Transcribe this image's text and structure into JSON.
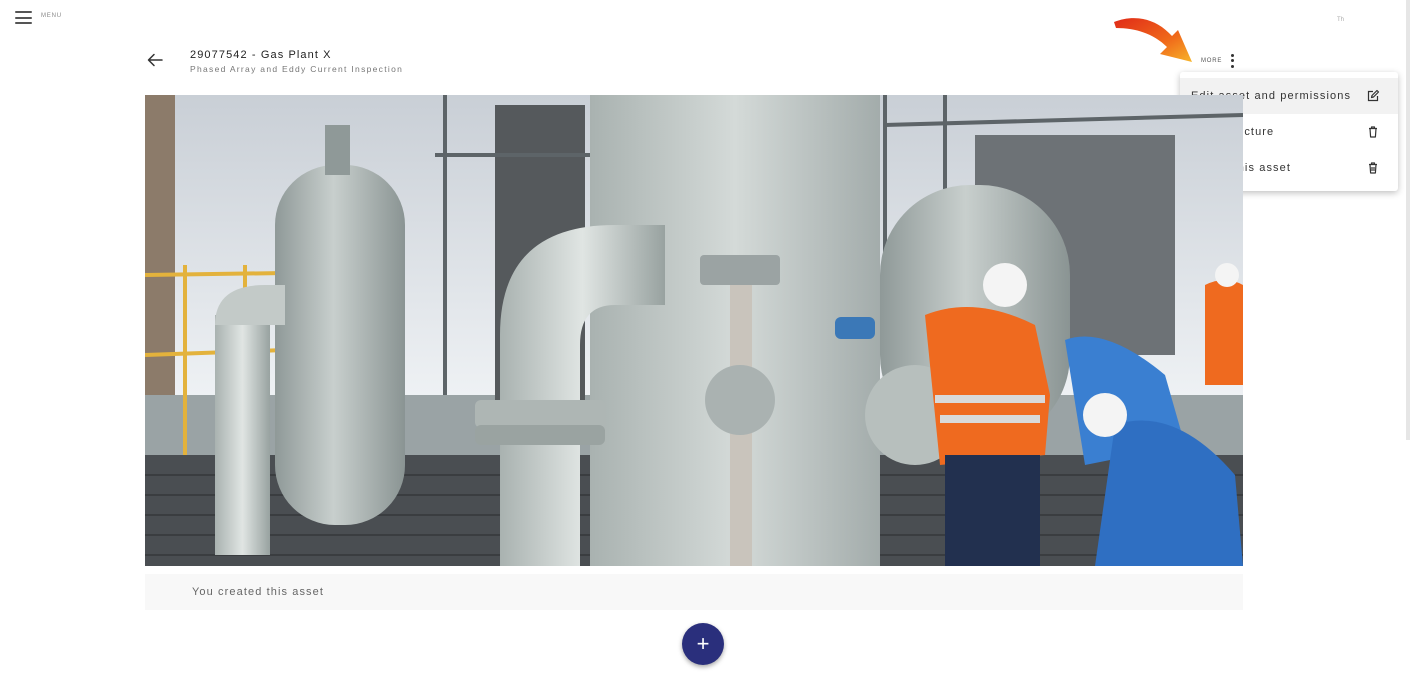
{
  "header": {
    "menu_label": "MENU",
    "user_initials": "Th"
  },
  "asset": {
    "title": "29077542 - Gas Plant X",
    "subtitle": "Phased Array and Eddy Current Inspection"
  },
  "more": {
    "label": "MORE",
    "menu_items": [
      {
        "label": "Edit asset and permissions",
        "icon": "edit-icon"
      },
      {
        "label": "Delete picture",
        "icon": "trash-icon"
      },
      {
        "label": "Delete this asset",
        "icon": "trash-icon"
      }
    ]
  },
  "activity": {
    "text": "You created this asset"
  },
  "fab": {
    "label": "+"
  },
  "colors": {
    "fab": "#2a2f7c",
    "annotation_arrow": "#ef5a1a"
  }
}
